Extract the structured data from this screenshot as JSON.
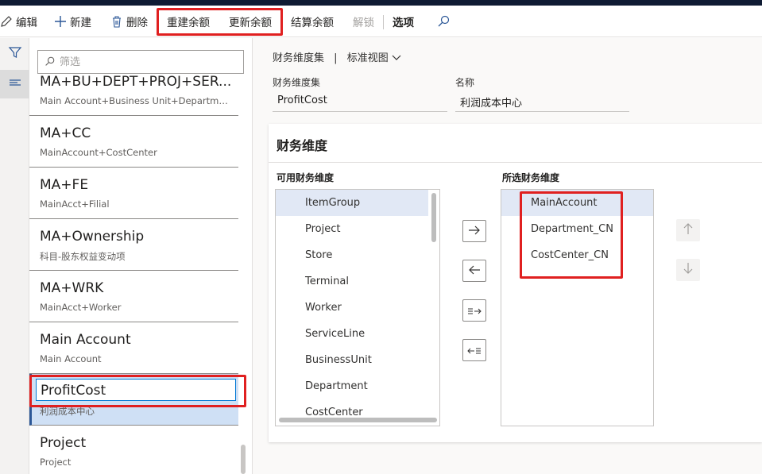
{
  "toolbar": {
    "edit": "编辑",
    "new": "新建",
    "delete": "删除",
    "rebuild_balance": "重建余额",
    "update_balance": "更新余额",
    "settle_balance": "结算余额",
    "unlock": "解锁",
    "options": "选项"
  },
  "filter": {
    "placeholder": "筛选"
  },
  "list": [
    {
      "name": "MA+BU+DEPT+PROJ+SER...",
      "desc": "Main Account+Business Unit+Department..."
    },
    {
      "name": "MA+CC",
      "desc": "MainAccount+CostCenter"
    },
    {
      "name": "MA+FE",
      "desc": "MainAcct+Filial"
    },
    {
      "name": "MA+Ownership",
      "desc": "科目-股东权益变动项"
    },
    {
      "name": "MA+WRK",
      "desc": "MainAcct+Worker"
    },
    {
      "name": "Main Account",
      "desc": "Main Account"
    },
    {
      "name": "ProfitCost",
      "desc": "利润成本中心"
    },
    {
      "name": "Project",
      "desc": "Project"
    }
  ],
  "breadcrumb": {
    "title": "财务维度集",
    "sep": "|",
    "view": "标准视图"
  },
  "fields": {
    "set_label": "财务维度集",
    "set_value": "ProfitCost",
    "name_label": "名称",
    "name_value": "利润成本中心"
  },
  "card": {
    "title": "财务维度",
    "available_label": "可用财务维度",
    "selected_label": "所选财务维度",
    "available": [
      "ItemGroup",
      "Project",
      "Store",
      "Terminal",
      "Worker",
      "ServiceLine",
      "BusinessUnit",
      "Department",
      "CostCenter"
    ],
    "selected": [
      "MainAccount",
      "Department_CN",
      "CostCenter_CN"
    ]
  },
  "icons": {
    "edit": "pencil-icon",
    "new": "plus-icon",
    "delete": "trash-icon",
    "search": "search-icon",
    "filter": "filter-icon",
    "list": "list-icon",
    "move_right": "arrow-right-icon",
    "move_left": "arrow-left-icon",
    "move_all_right": "move-all-right-icon",
    "move_all_left": "move-all-left-icon",
    "up": "arrow-up-icon",
    "down": "arrow-down-icon",
    "chevron": "chevron-down-icon"
  },
  "colors": {
    "highlight_box": "#e02020",
    "selection": "#cfe0f5",
    "accent": "#0078d4"
  }
}
